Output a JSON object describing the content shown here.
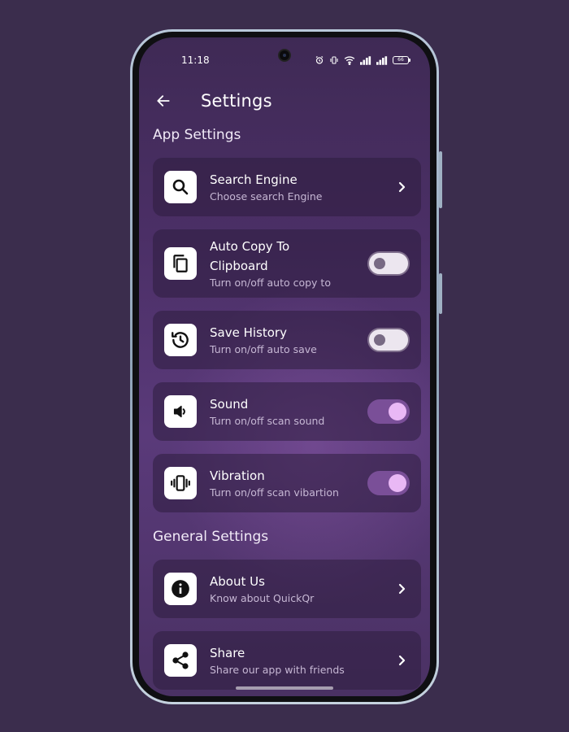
{
  "status_bar": {
    "time": "11:18",
    "battery": "66"
  },
  "header": {
    "title": "Settings"
  },
  "sections": {
    "app": "App Settings",
    "general": "General Settings"
  },
  "items": {
    "search_engine": {
      "title": "Search Engine",
      "subtitle": "Choose search Engine",
      "icon": "search-icon"
    },
    "auto_copy": {
      "title_line1": "Auto Copy To",
      "title_line2": "Clipboard",
      "subtitle": "Turn on/off auto copy to",
      "icon": "copy-icon",
      "enabled": false
    },
    "save_history": {
      "title": "Save History",
      "subtitle": "Turn on/off auto save",
      "icon": "history-icon",
      "enabled": false
    },
    "sound": {
      "title": "Sound",
      "subtitle": "Turn on/off scan sound",
      "icon": "speaker-icon",
      "enabled": true
    },
    "vibration": {
      "title": "Vibration",
      "subtitle": "Turn on/off scan vibartion",
      "icon": "vibration-icon",
      "enabled": true
    },
    "about": {
      "title": "About Us",
      "subtitle": "Know about QuickQr",
      "icon": "info-icon"
    },
    "share": {
      "title": "Share",
      "subtitle": "Share our app with friends",
      "icon": "share-icon"
    }
  },
  "colors": {
    "background": "#3b2d4d",
    "toggle_on_track": "#7a4f98",
    "toggle_on_knob": "#e9b8f5",
    "toggle_off_track": "#ece6ef"
  }
}
